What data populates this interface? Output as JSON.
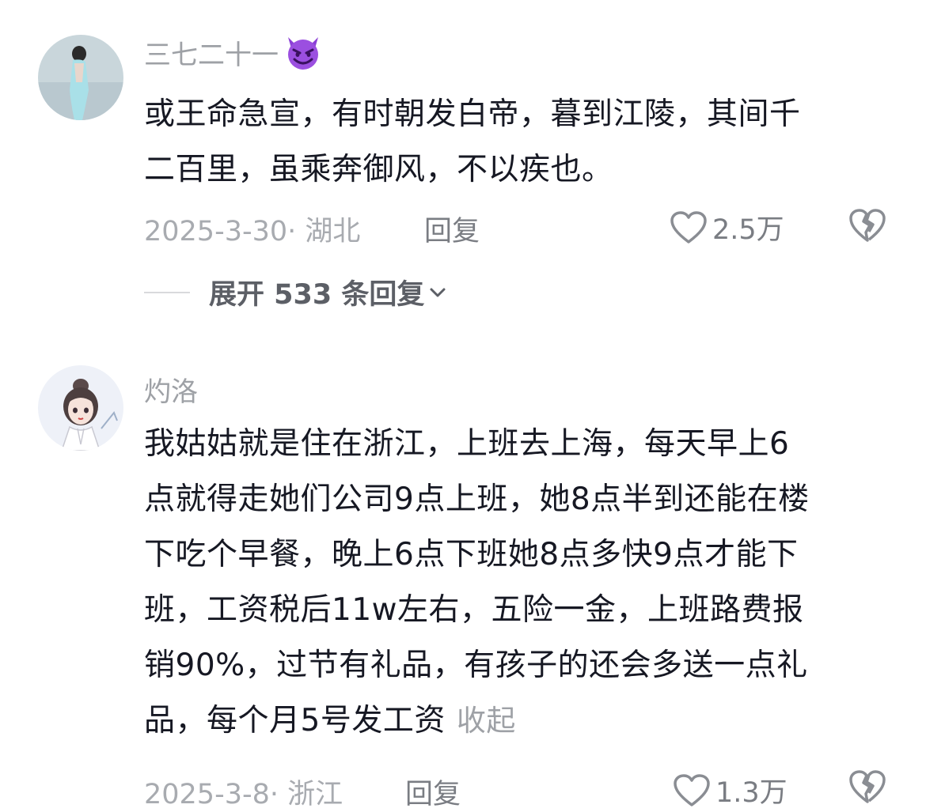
{
  "comments": [
    {
      "username": "三七二十一",
      "username_emoji": "smiling-devil-emoji",
      "text_lines": [
        "或王命急宣，有时朝发白帝，暮到江陵，其间千",
        "二百里，虽乘奔御风，不以疾也。"
      ],
      "date_location": "2025-3-30· 湖北",
      "reply_label": "回复",
      "like_count": "2.5万",
      "expand_replies": "展开 533 条回复"
    },
    {
      "username": "灼洛",
      "text_lines": [
        "我姑姑就是住在浙江，上班去上海，每天早上6",
        "点就得走她们公司9点上班，她8点半到还能在楼",
        "下吃个早餐，晚上6点下班她8点多快9点才能下",
        "班，工资税后11w左右，五险一金，上班路费报",
        "销90%，过节有礼品，有孩子的还会多送一点礼",
        "品，每个月5号发工资"
      ],
      "collapse_label": "收起",
      "date_location": "2025-3-8· 浙江",
      "reply_label": "回复",
      "like_count": "1.3万"
    }
  ],
  "colors": {
    "text_primary": "#161823",
    "text_secondary": "#9ea1a6",
    "devil_purple": "#8b3fd6"
  },
  "icons": [
    "heart-outline-icon",
    "broken-heart-icon",
    "chevron-down-icon"
  ]
}
